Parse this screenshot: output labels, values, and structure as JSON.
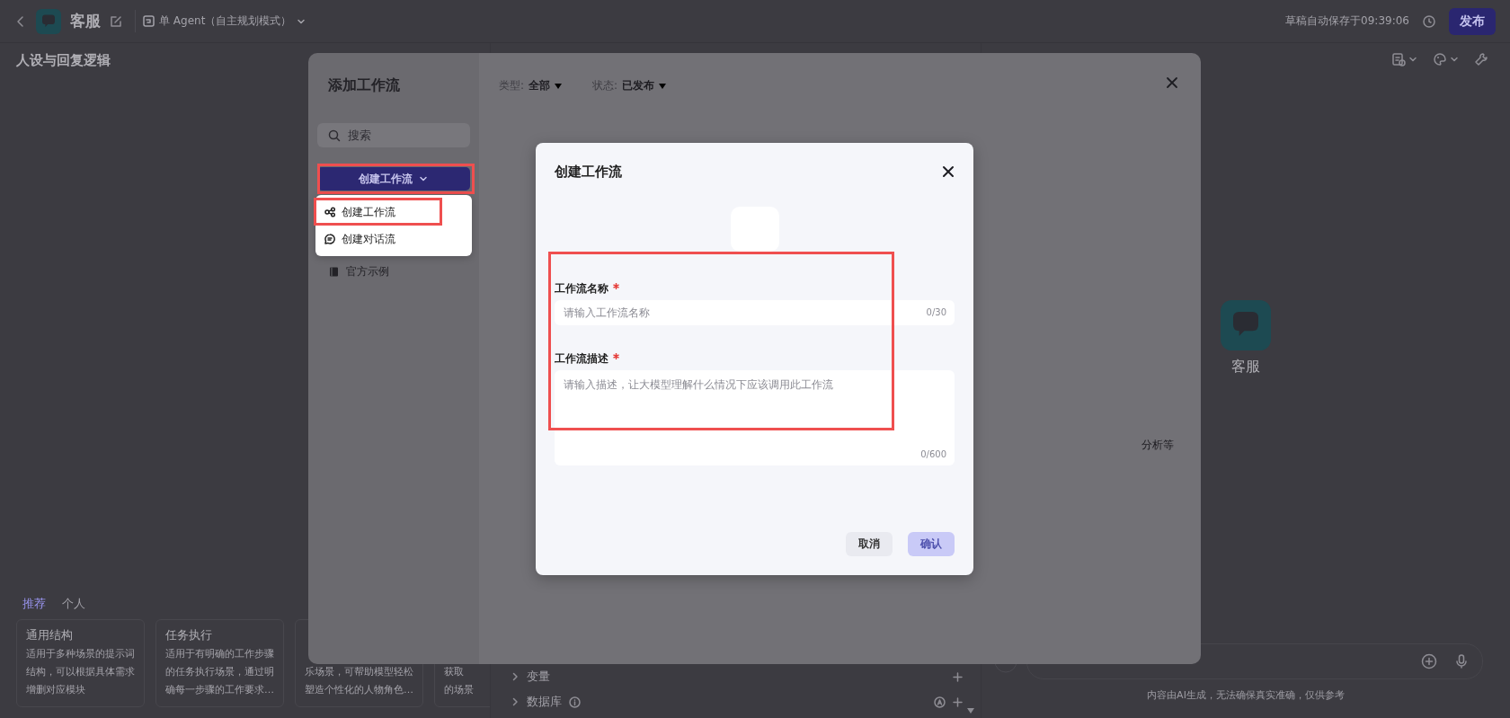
{
  "top_bar": {
    "app_name": "客服",
    "mode": "单 Agent（自主规划模式）",
    "autosave": "草稿自动保存于09:39:06",
    "publish_button": "发布"
  },
  "left_panel": {
    "title": "人设与回复逻辑",
    "tabs": [
      {
        "label": "推荐",
        "selected": true
      },
      {
        "label": "个人",
        "selected": false
      }
    ],
    "cards": [
      {
        "title": "通用结构",
        "lines": [
          "适用于多种场景的提示词",
          "结构，可以根据具体需求",
          "增删对应模块"
        ]
      },
      {
        "title": "任务执行",
        "lines": [
          "适用于有明确的工作步骤",
          "的任务执行场景，通过明",
          "确每一步骤的工作要求…"
        ]
      },
      {
        "lines": [
          "乐场景，可帮助模型轻松",
          "塑造个性化的人物角色…"
        ]
      },
      {
        "lines": [
          "获取",
          "的场景"
        ]
      }
    ]
  },
  "skills_panel": {
    "items": [
      {
        "label": "变量",
        "kind": "plain"
      },
      {
        "label": "数据库",
        "kind": "info"
      }
    ]
  },
  "preview_panel": {
    "bot_name": "客服",
    "input_note": "内容由AI生成，无法确保真实准确，仅供参考"
  },
  "add_workflow_dialog": {
    "title": "添加工作流",
    "search": {
      "placeholder": "搜索"
    },
    "create_button": {
      "label": "创建工作流",
      "highlighted": true
    },
    "menu": [
      {
        "label": "创建工作流",
        "kind": "workflow",
        "highlighted": true
      },
      {
        "label": "创建对话流",
        "kind": "chatflow",
        "highlighted": false
      }
    ],
    "nav": [
      {
        "label": "官方示例"
      }
    ],
    "filters": [
      {
        "label": "类型:",
        "value": "全部"
      },
      {
        "label": "状态:",
        "value": "已发布"
      }
    ],
    "empty_hint": "分析等"
  },
  "create_dialog": {
    "title": "创建工作流",
    "highlighted": true,
    "fields": [
      {
        "label": "工作流名称",
        "required": true,
        "kind": "input",
        "placeholder": "请输入工作流名称",
        "counter": "0/30"
      },
      {
        "label": "工作流描述",
        "required": true,
        "kind": "textarea",
        "placeholder": "请输入描述，让大模型理解什么情况下应该调用此工作流",
        "counter": "0/600"
      }
    ],
    "buttons": [
      {
        "label": "取消",
        "disabled": false
      },
      {
        "label": "确认",
        "disabled": true
      }
    ]
  }
}
